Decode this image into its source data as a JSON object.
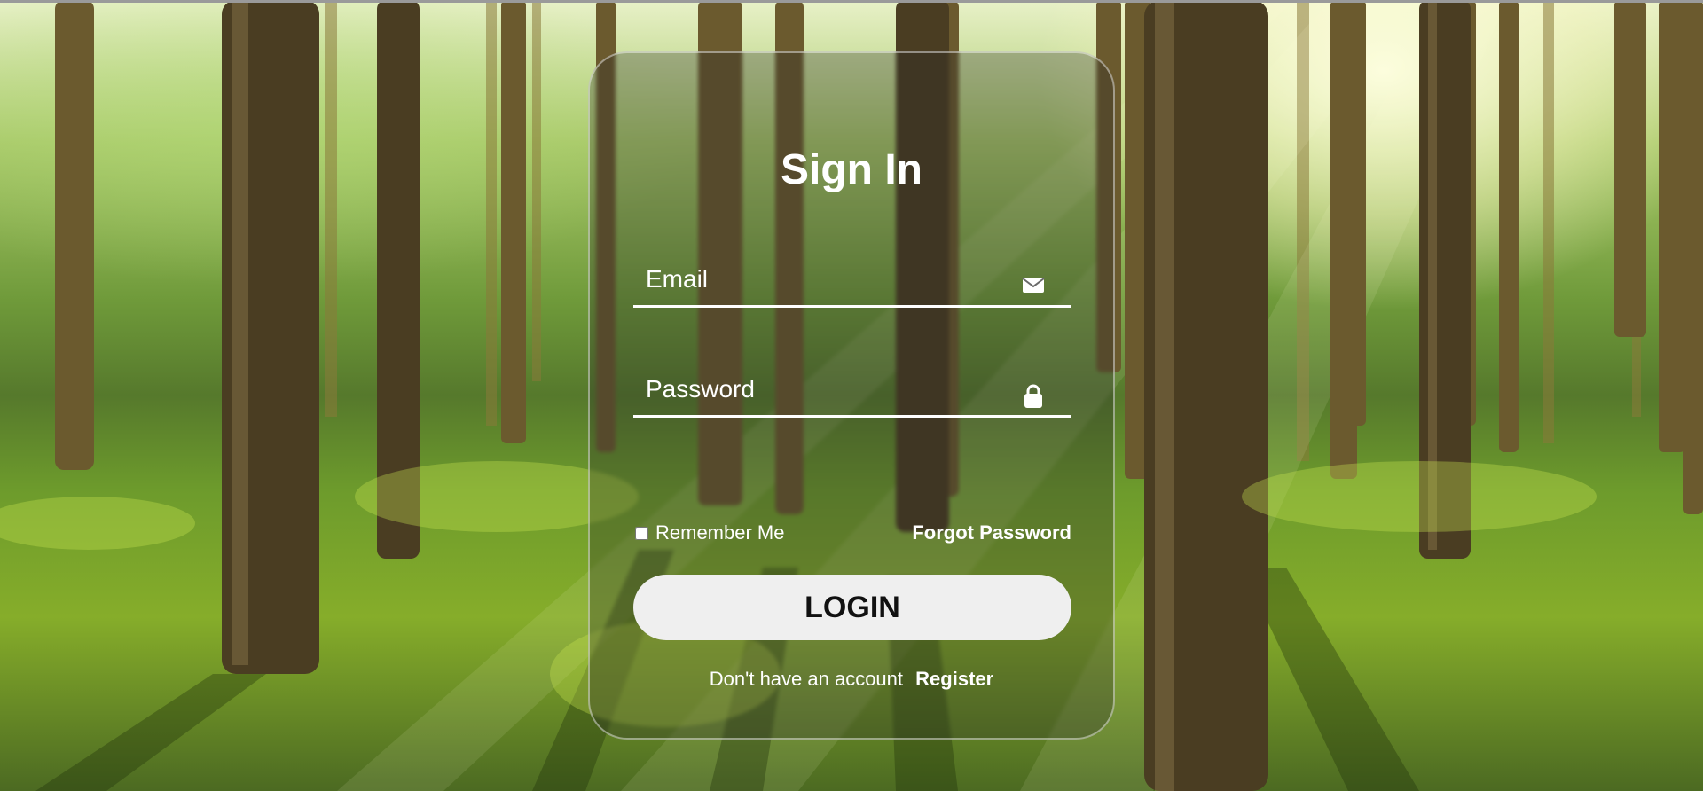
{
  "form": {
    "title": "Sign In",
    "email_placeholder": "Email",
    "password_placeholder": "Password",
    "email_icon": "envelope-icon",
    "password_icon": "lock-icon",
    "remember_label": "Remember Me",
    "remember_checked": false,
    "forgot_label": "Forgot Password",
    "login_label": "LOGIN",
    "no_account_text": "Don't have an account",
    "register_label": "Register"
  },
  "background": {
    "image": "forest-background"
  }
}
